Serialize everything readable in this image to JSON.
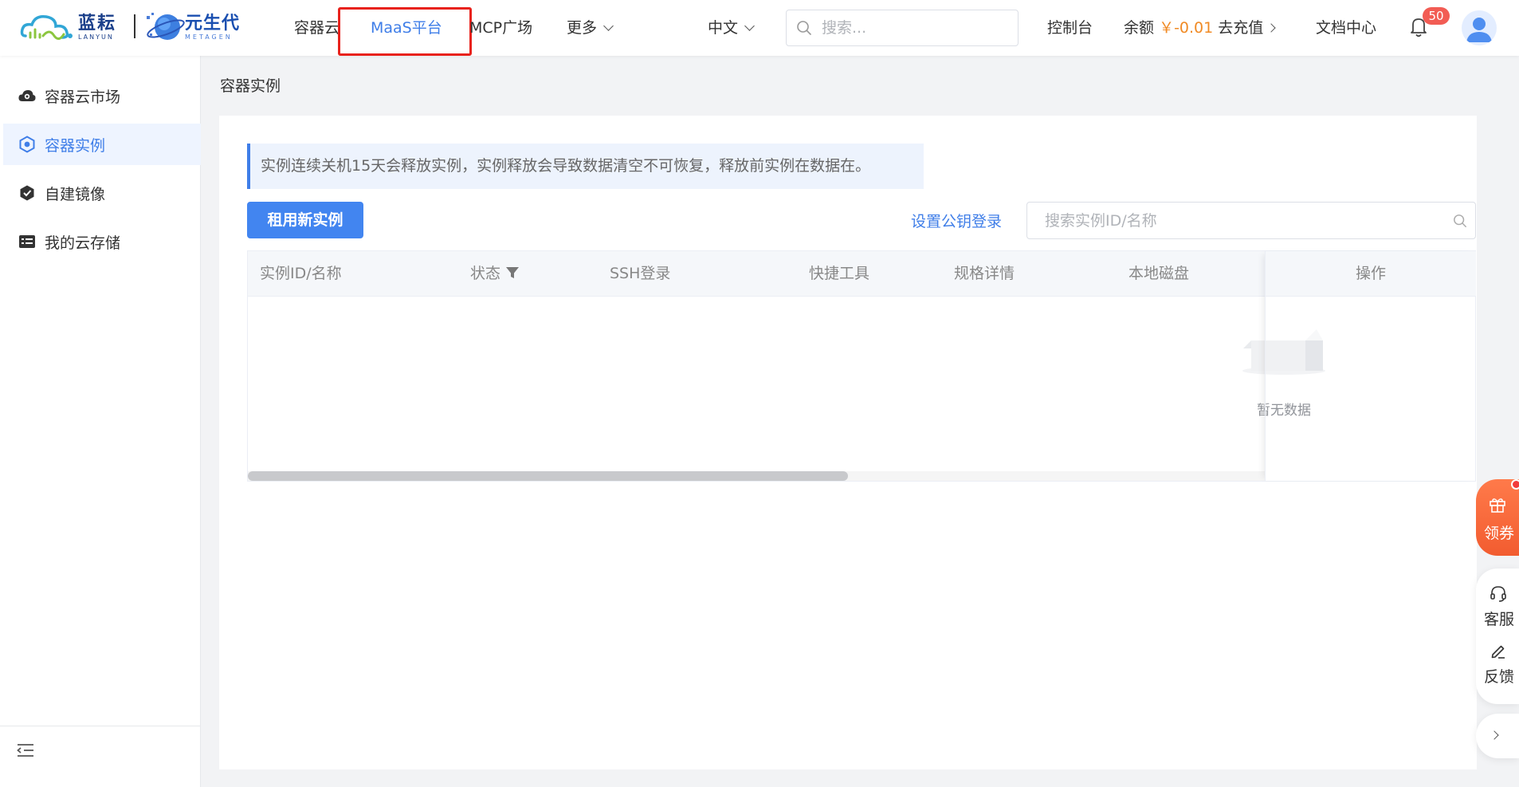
{
  "header": {
    "logo1": {
      "cn": "蓝耘",
      "en": "LANYUN"
    },
    "logo2": {
      "cn": "元生代",
      "en": "METAGEN"
    },
    "nav": {
      "container_cloud": "容器云",
      "maas": "MaaS平台",
      "mcp": "MCP广场",
      "more": "更多"
    },
    "language": "中文",
    "search_placeholder": "搜索...",
    "console": "控制台",
    "balance_label": "余额",
    "balance_value": "￥-0.01",
    "recharge": "去充值",
    "docs": "文档中心",
    "notification_count": "50"
  },
  "sidebar": {
    "items": [
      {
        "label": "容器云市场",
        "icon": "cloud-market-icon"
      },
      {
        "label": "容器实例",
        "icon": "container-instance-icon"
      },
      {
        "label": "自建镜像",
        "icon": "custom-image-icon"
      },
      {
        "label": "我的云存储",
        "icon": "cloud-storage-icon"
      }
    ],
    "active_index": 1
  },
  "main": {
    "page_title": "容器实例",
    "alert": "实例连续关机15天会释放实例，实例释放会导致数据清空不可恢复，释放前实例在数据在。",
    "new_instance_button": "租用新实例",
    "set_key_link": "设置公钥登录",
    "search_placeholder": "搜索实例ID/名称",
    "table": {
      "columns": [
        "实例ID/名称",
        "状态",
        "SSH登录",
        "快捷工具",
        "规格详情",
        "本地磁盘",
        "操作"
      ],
      "rows": [],
      "empty_text": "暂无数据",
      "horizontal_scroll_fraction": 0.59
    }
  },
  "floating": {
    "coupon": "领券",
    "service": "客服",
    "feedback": "反馈"
  },
  "colors": {
    "accent": "#3f7ee8",
    "primary_button": "#4285f0",
    "balance": "#f08a24",
    "highlight_box": "#e8221c",
    "badge": "#f25c54",
    "coupon": "#f25c30"
  }
}
